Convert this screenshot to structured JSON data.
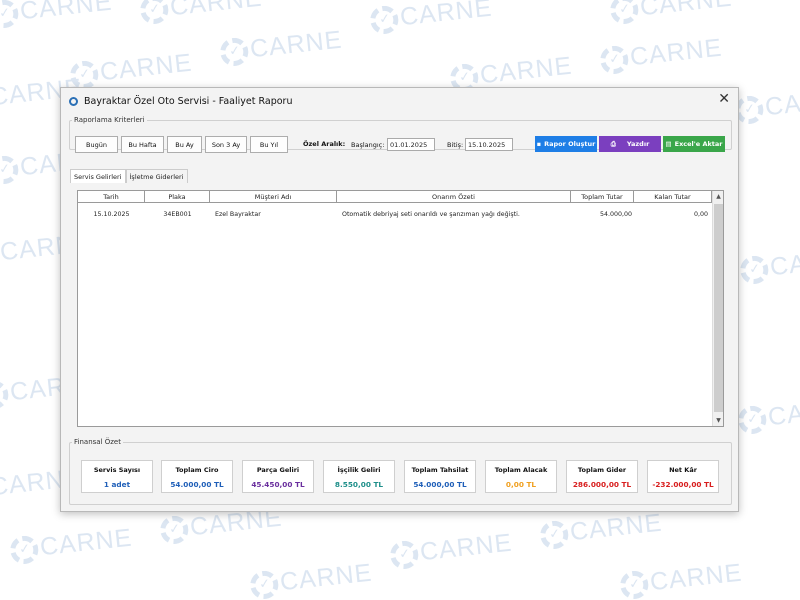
{
  "watermark": "CARNE",
  "window": {
    "title": "Bayraktar Özel Oto Servisi - Faaliyet Raporu",
    "close_label": "✕"
  },
  "criteria": {
    "legend": "Raporlama Kriterleri",
    "quick_buttons": [
      "Bugün",
      "Bu Hafta",
      "Bu Ay",
      "Son 3 Ay",
      "Bu Yıl"
    ],
    "custom_range_label": "Özel Aralık:",
    "start_label": "Başlangıç:",
    "start_value": "01.01.2025",
    "end_label": "Bitiş:",
    "end_value": "15.10.2025",
    "create_report": "Rapor Oluştur",
    "print": "Yazdır",
    "export_excel": "Excel'e Aktar",
    "colors": {
      "create": "#1e7ee6",
      "print": "#7b3fbf",
      "excel": "#3aa64a"
    }
  },
  "tabs": [
    "Servis Gelirleri",
    "İşletme Giderleri"
  ],
  "table": {
    "columns": [
      "Tarih",
      "Plaka",
      "Müşteri Adı",
      "Onarım Özeti",
      "Toplam Tutar",
      "Kalan Tutar"
    ],
    "rows": [
      [
        "15.10.2025",
        "34EB001",
        "Ezel Bayraktar",
        "Otomatik debriyaj seti onarıldı ve şanzıman yağı değişti.",
        "54.000,00",
        "0,00"
      ]
    ]
  },
  "summary": {
    "legend": "Finansal Özet",
    "cards": [
      {
        "title": "Servis Sayısı",
        "value": "1 adet",
        "color": "#1f5fb8"
      },
      {
        "title": "Toplam Ciro",
        "value": "54.000,00 TL",
        "color": "#1f5fb8"
      },
      {
        "title": "Parça Geliri",
        "value": "45.450,00 TL",
        "color": "#6a2f9e"
      },
      {
        "title": "İşçilik Geliri",
        "value": "8.550,00 TL",
        "color": "#1e8f8a"
      },
      {
        "title": "Toplam Tahsilat",
        "value": "54.000,00 TL",
        "color": "#1f5fb8"
      },
      {
        "title": "Toplam Alacak",
        "value": "0,00 TL",
        "color": "#f0a020"
      },
      {
        "title": "Toplam Gider",
        "value": "286.000,00 TL",
        "color": "#d81e1e"
      },
      {
        "title": "Net Kâr",
        "value": "-232.000,00 TL",
        "color": "#d81e1e"
      }
    ]
  }
}
